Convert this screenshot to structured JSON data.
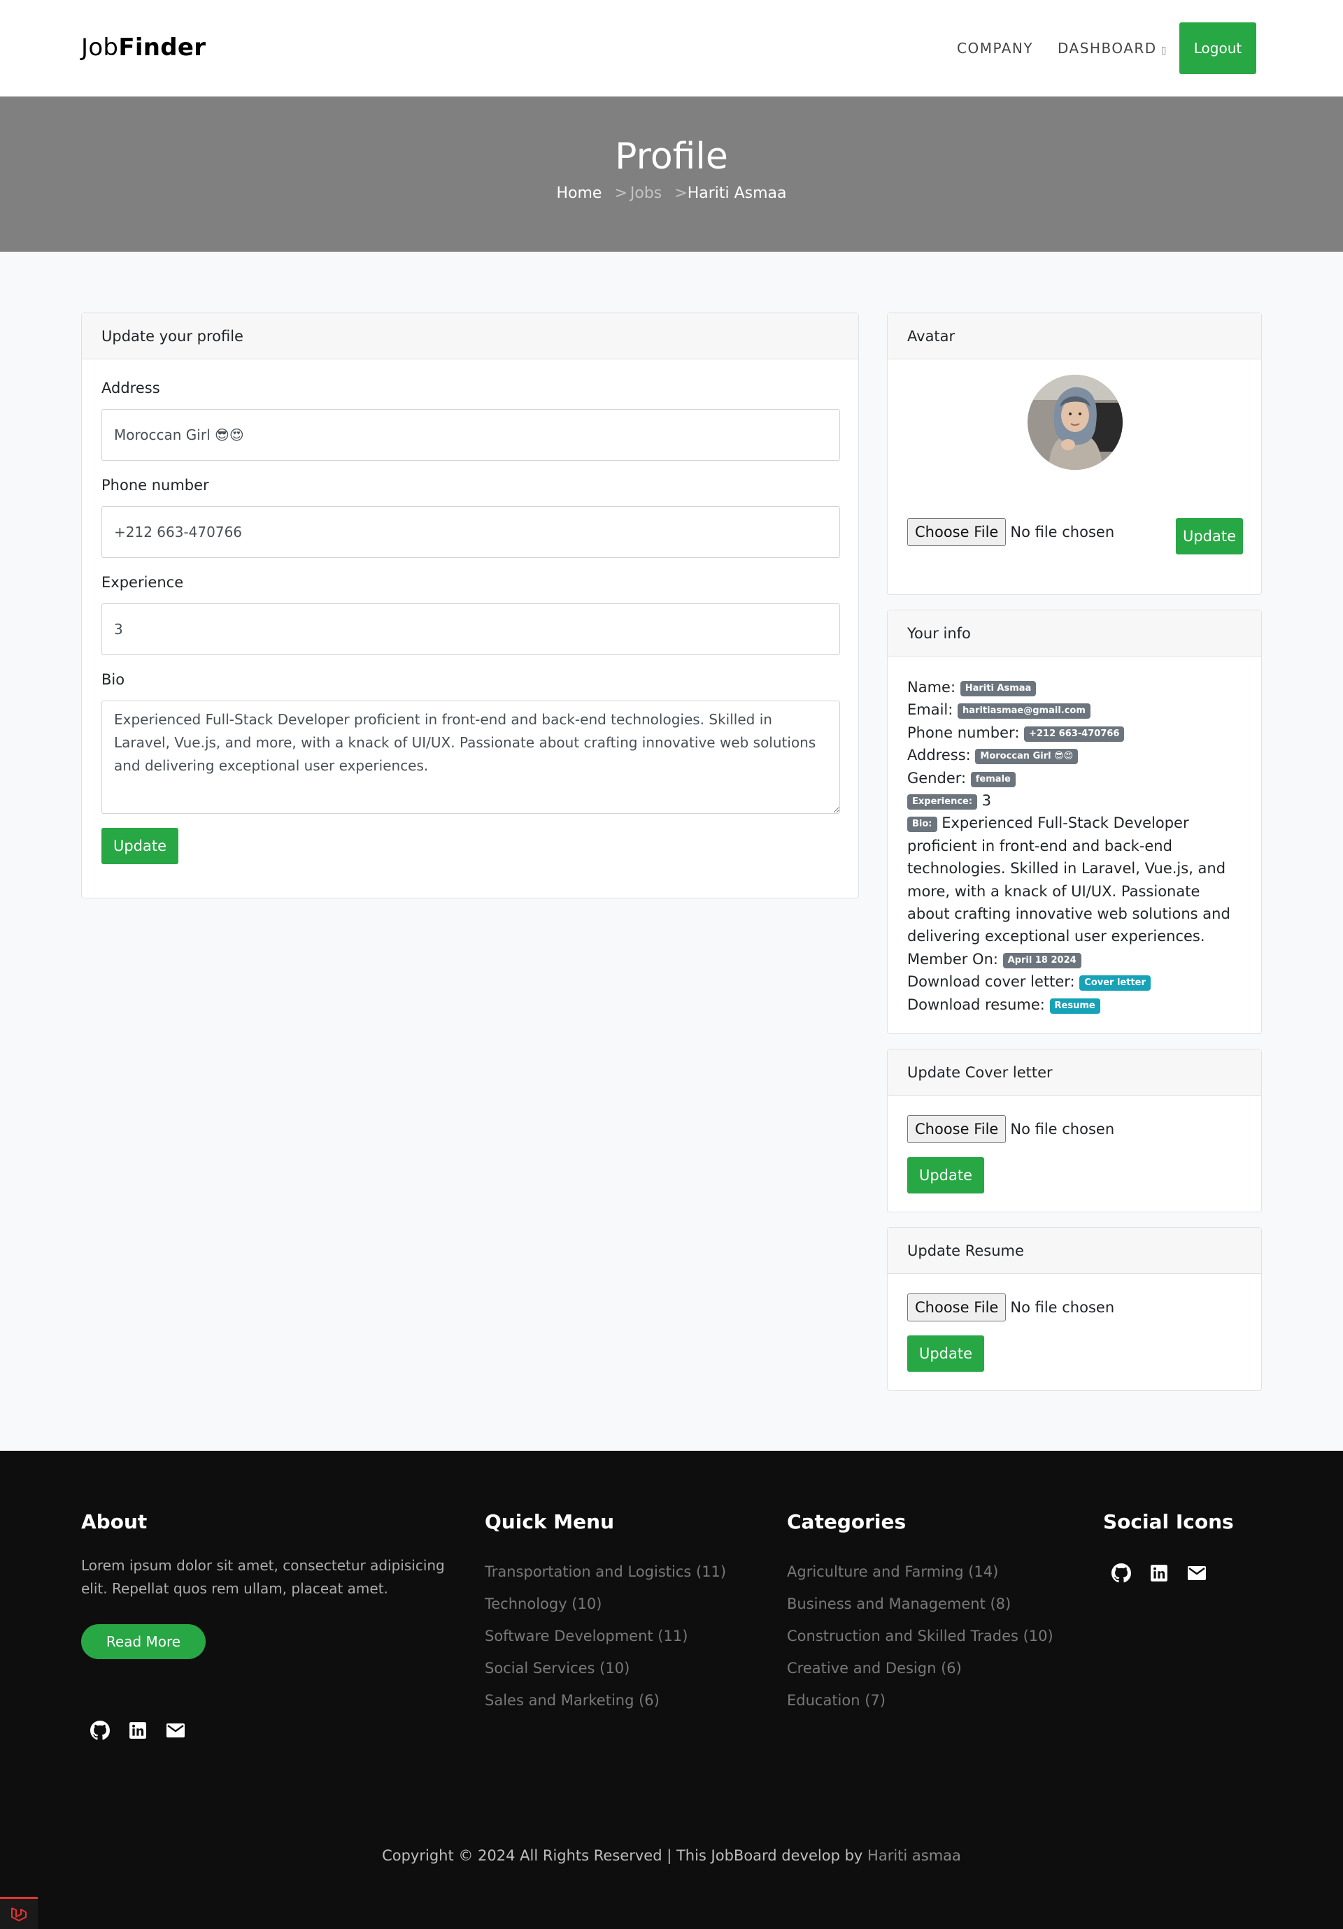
{
  "navbar": {
    "brand_light": "Job",
    "brand_bold": "Finder",
    "company": "COMPANY",
    "dashboard": "DASHBOARD",
    "logout": "Logout"
  },
  "hero": {
    "title": "Profile",
    "breadcrumb_home": "Home",
    "breadcrumb_sep1": ">",
    "breadcrumb_jobs": "Jobs",
    "breadcrumb_sep2": ">",
    "breadcrumb_current": "Hariti Asmaa"
  },
  "profile_form": {
    "header": "Update your profile",
    "address_label": "Address",
    "address_value": "Moroccan Girl 😎😍",
    "phone_label": "Phone number",
    "phone_value": "+212 663-470766",
    "experience_label": "Experience",
    "experience_value": "3",
    "bio_label": "Bio",
    "bio_value": "Experienced Full-Stack Developer proficient in front-end and back-end technologies. Skilled in Laravel, Vue.js, and more, with a knack of UI/UX. Passionate about crafting innovative web solutions and delivering exceptional user experiences.",
    "update_button": "Update"
  },
  "avatar_card": {
    "header": "Avatar",
    "choose_file": "Choose File",
    "no_file": "No file chosen",
    "update_button": "Update"
  },
  "info_card": {
    "header": "Your info",
    "name_label": "Name:",
    "name_value": "Hariti Asmaa",
    "email_label": "Email:",
    "email_value": "haritiasmae@gmail.com",
    "phone_label": "Phone number:",
    "phone_value": "+212 663-470766",
    "address_label": "Address:",
    "address_value": "Moroccan Girl 😎😍",
    "gender_label": "Gender:",
    "gender_value": "female",
    "experience_badge": "Experience:",
    "experience_value": "3",
    "bio_badge": "Bio:",
    "bio_value": "Experienced Full-Stack Developer proficient in front-end and back-end technologies. Skilled in Laravel, Vue.js, and more, with a knack of UI/UX. Passionate about crafting innovative web solutions and delivering exceptional user experiences.",
    "member_label": "Member On:",
    "member_value": "April 18 2024",
    "cover_label": "Download cover letter:",
    "cover_link": "Cover letter",
    "resume_label": "Download resume:",
    "resume_link": "Resume"
  },
  "cover_card": {
    "header": "Update Cover letter",
    "choose_file": "Choose File",
    "no_file": "No file chosen",
    "update_button": "Update"
  },
  "resume_card": {
    "header": "Update Resume",
    "choose_file": "Choose File",
    "no_file": "No file chosen",
    "update_button": "Update"
  },
  "footer": {
    "about_heading": "About",
    "about_text": "Lorem ipsum dolor sit amet, consectetur adipisicing elit. Repellat quos rem ullam, placeat amet.",
    "read_more": "Read More",
    "quick_menu_heading": "Quick Menu",
    "quick_menu": [
      "Transportation and Logistics (11)",
      "Technology (10)",
      "Software Development (11)",
      "Social Services (10)",
      "Sales and Marketing (6)"
    ],
    "categories_heading": "Categories",
    "categories": [
      "Agriculture and Farming (14)",
      "Business and Management (8)",
      "Construction and Skilled Trades (10)",
      "Creative and Design (6)",
      "Education (7)"
    ],
    "social_heading": "Social Icons",
    "copyright": "Copyright © 2024 All Rights Reserved | This JobBoard develop by",
    "copyright_author": "Hariti asmaa"
  },
  "icons": {
    "social": [
      "github-icon",
      "linkedin-icon",
      "email-icon"
    ],
    "dev_tab": "laravel-icon"
  },
  "colors": {
    "primary": "#28a745",
    "hero_bg": "#808080",
    "footer_bg": "#0e0e0e",
    "badge_secondary": "#6c757d",
    "badge_info": "#17a2b8"
  }
}
